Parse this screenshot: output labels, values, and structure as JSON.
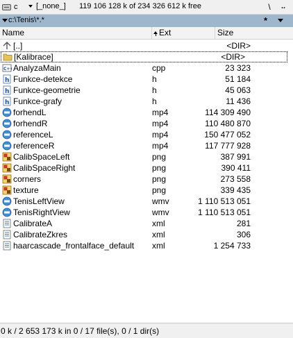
{
  "drivebar": {
    "drive_letter": "c",
    "volume_label": "[_none_]",
    "free_space": "119 106 128 k of 234 326 612 k free",
    "root_button": "\\",
    "up_button": ".."
  },
  "pathbar": {
    "path": "c:\\Tenis\\*.*",
    "filter_symbol": "*"
  },
  "columns": {
    "name": "Name",
    "ext": "Ext",
    "size": "Size"
  },
  "files": [
    {
      "name": "[..]",
      "ext": "",
      "size": "<DIR>",
      "icon": "up-dir-icon"
    },
    {
      "name": "[Kalibrace]",
      "ext": "",
      "size": "<DIR>",
      "icon": "folder-icon"
    },
    {
      "name": "AnalyzaMain",
      "ext": "cpp",
      "size": "23 323",
      "icon": "cpp-file-icon"
    },
    {
      "name": "Funkce-detekce",
      "ext": "h",
      "size": "51 184",
      "icon": "header-file-icon"
    },
    {
      "name": "Funkce-geometrie",
      "ext": "h",
      "size": "45 063",
      "icon": "header-file-icon"
    },
    {
      "name": "Funkce-grafy",
      "ext": "h",
      "size": "11 436",
      "icon": "header-file-icon"
    },
    {
      "name": "forhendL",
      "ext": "mp4",
      "size": "114 309 490",
      "icon": "video-file-icon"
    },
    {
      "name": "forhendR",
      "ext": "mp4",
      "size": "110 480 870",
      "icon": "video-file-icon"
    },
    {
      "name": "referenceL",
      "ext": "mp4",
      "size": "150 477 052",
      "icon": "video-file-icon"
    },
    {
      "name": "referenceR",
      "ext": "mp4",
      "size": "117 777 928",
      "icon": "video-file-icon"
    },
    {
      "name": "CalibSpaceLeft",
      "ext": "png",
      "size": "387 991",
      "icon": "image-file-icon"
    },
    {
      "name": "CalibSpaceRight",
      "ext": "png",
      "size": "390 411",
      "icon": "image-file-icon"
    },
    {
      "name": "corners",
      "ext": "png",
      "size": "273 558",
      "icon": "image-file-icon"
    },
    {
      "name": "texture",
      "ext": "png",
      "size": "339 435",
      "icon": "image-file-icon"
    },
    {
      "name": "TenisLeftView",
      "ext": "wmv",
      "size": "1 110 513 051",
      "icon": "video-file-icon"
    },
    {
      "name": "TenisRightView",
      "ext": "wmv",
      "size": "1 110 513 051",
      "icon": "video-file-icon"
    },
    {
      "name": "CalibrateA",
      "ext": "xml",
      "size": "281",
      "icon": "xml-file-icon"
    },
    {
      "name": "CalibrateZkres",
      "ext": "xml",
      "size": "306",
      "icon": "xml-file-icon"
    },
    {
      "name": "haarcascade_frontalface_default",
      "ext": "xml",
      "size": "1 254 733",
      "icon": "xml-file-icon"
    }
  ],
  "focused_index": 1,
  "status": "0 k / 2 653 173 k in 0 / 17 file(s), 0 / 1 dir(s)"
}
